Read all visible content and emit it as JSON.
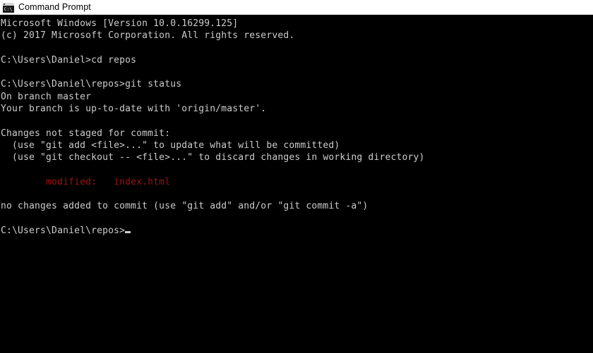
{
  "window": {
    "title": "Command Prompt",
    "icon": "cmd-icon",
    "background_color": "#000000",
    "titlebar_color": "#ffffff",
    "text_color": "#cccccc",
    "accent_color": "#9c1212"
  },
  "console": {
    "prompt_cursor": "block-cursor",
    "lines": [
      {
        "text": "Microsoft Windows [Version 10.0.16299.125]",
        "color": "default"
      },
      {
        "text": "(c) 2017 Microsoft Corporation. All rights reserved.",
        "color": "default"
      },
      {
        "text": "",
        "color": "default"
      },
      {
        "text": "C:\\Users\\Daniel>cd repos",
        "color": "default"
      },
      {
        "text": "",
        "color": "default"
      },
      {
        "text": "C:\\Users\\Daniel\\repos>git status",
        "color": "default"
      },
      {
        "text": "On branch master",
        "color": "default"
      },
      {
        "text": "Your branch is up-to-date with 'origin/master'.",
        "color": "default"
      },
      {
        "text": "",
        "color": "default"
      },
      {
        "text": "Changes not staged for commit:",
        "color": "default"
      },
      {
        "text": "  (use \"git add <file>...\" to update what will be committed)",
        "color": "default"
      },
      {
        "text": "  (use \"git checkout -- <file>...\" to discard changes in working directory)",
        "color": "default"
      },
      {
        "text": "",
        "color": "default"
      },
      {
        "text": "        modified:   index.html",
        "color": "red"
      },
      {
        "text": "",
        "color": "default"
      },
      {
        "text": "no changes added to commit (use \"git add\" and/or \"git commit -a\")",
        "color": "default"
      },
      {
        "text": "",
        "color": "default"
      }
    ],
    "final_prompt": "C:\\Users\\Daniel\\repos>"
  }
}
